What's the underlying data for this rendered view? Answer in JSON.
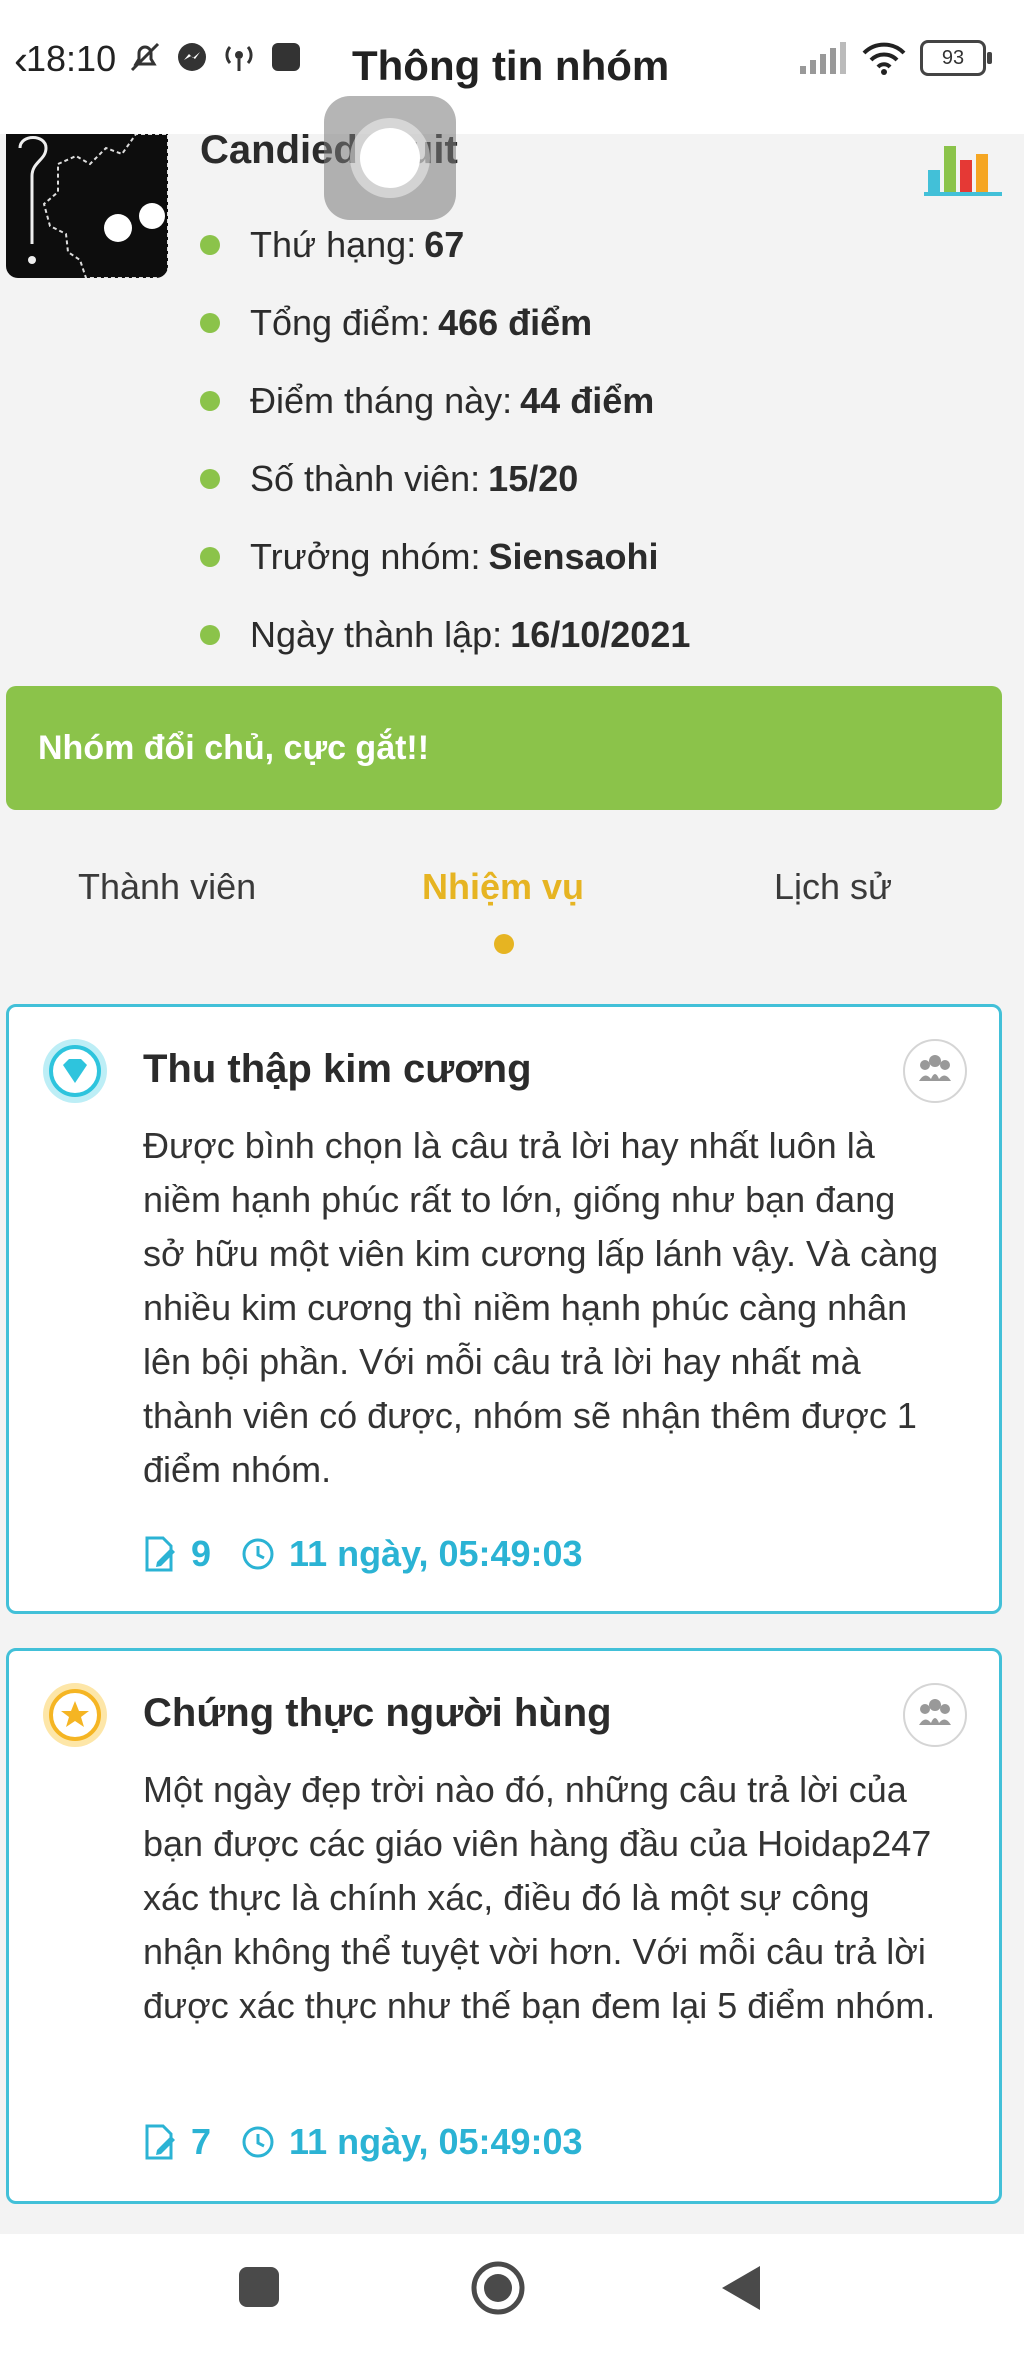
{
  "status_bar": {
    "time": "18:10",
    "battery": "93"
  },
  "header": {
    "title": "Thông tin nhóm"
  },
  "group": {
    "name": "Candied Fruit",
    "stats": [
      {
        "label": "Thứ hạng:",
        "value": "67"
      },
      {
        "label": "Tổng điểm:",
        "value": "466 điểm"
      },
      {
        "label": "Điểm tháng này:",
        "value": "44 điểm"
      },
      {
        "label": "Số thành viên:",
        "value": "15/20"
      },
      {
        "label": "Trưởng nhóm:",
        "value": "Siensaohi"
      },
      {
        "label": "Ngày thành lập:",
        "value": "16/10/2021"
      }
    ]
  },
  "announcement": "Nhóm đổi chủ, cực gắt!!",
  "tabs": [
    {
      "label": "Thành viên",
      "active": false
    },
    {
      "label": "Nhiệm vụ",
      "active": true
    },
    {
      "label": "Lịch sử",
      "active": false
    }
  ],
  "missions": [
    {
      "title": "Thu thập kim cương",
      "icon": "diamond-icon",
      "description": "Được bình chọn là câu trả lời hay nhất luôn là niềm hạnh phúc rất to lớn, giống như bạn đang sở hữu một viên kim cương lấp lánh vậy. Và càng nhiều kim cương thì niềm hạnh phúc càng nhân lên bội phần. Với mỗi câu trả lời hay nhất mà thành viên có được, nhóm sẽ nhận thêm được 1 điểm nhóm.",
      "count": "9",
      "time_left": "11 ngày, 05:49:03"
    },
    {
      "title": "Chứng thực người hùng",
      "icon": "star-icon",
      "description": "Một ngày đẹp trời nào đó, những câu trả lời của bạn được các giáo viên hàng đầu của Hoidap247 xác thực là chính xác, điều đó là một sự công nhận không thể tuyệt vời hơn. Với mỗi câu trả lời được xác thực như thế bạn đem lại 5 điểm nhóm.",
      "count": "7",
      "time_left": "11 ngày, 05:49:03"
    }
  ],
  "colors": {
    "accent_green": "#8bc34a",
    "tab_active": "#e6b422",
    "card_border": "#42c0d8",
    "meta_blue": "#2bb3d4"
  }
}
